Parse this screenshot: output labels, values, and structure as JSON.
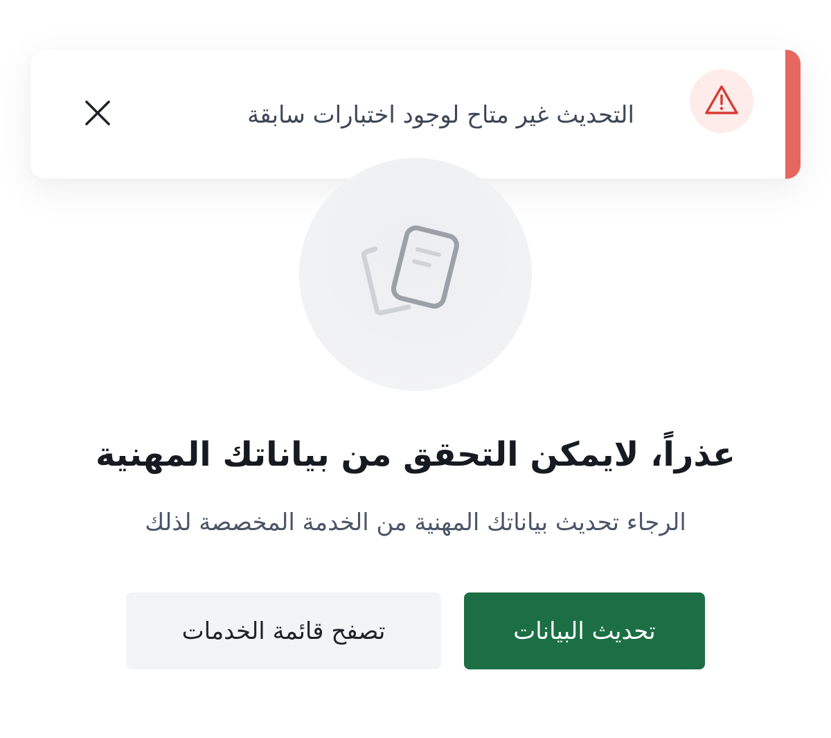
{
  "toast": {
    "message": "التحديث غير متاح لوجود اختبارات سابقة",
    "accent_color": "#e5675f",
    "icon": "warning-triangle-icon",
    "close_icon": "close-icon"
  },
  "illustration": {
    "icon": "documents-icon"
  },
  "main": {
    "title": "عذراً، لايمكن التحقق من بياناتك المهنية",
    "subtitle": "الرجاء تحديث بياناتك المهنية من الخدمة المخصصة لذلك"
  },
  "actions": {
    "primary_label": "تحديث البيانات",
    "primary_color": "#1c6f45",
    "secondary_label": "تصفح قائمة الخدمات"
  }
}
